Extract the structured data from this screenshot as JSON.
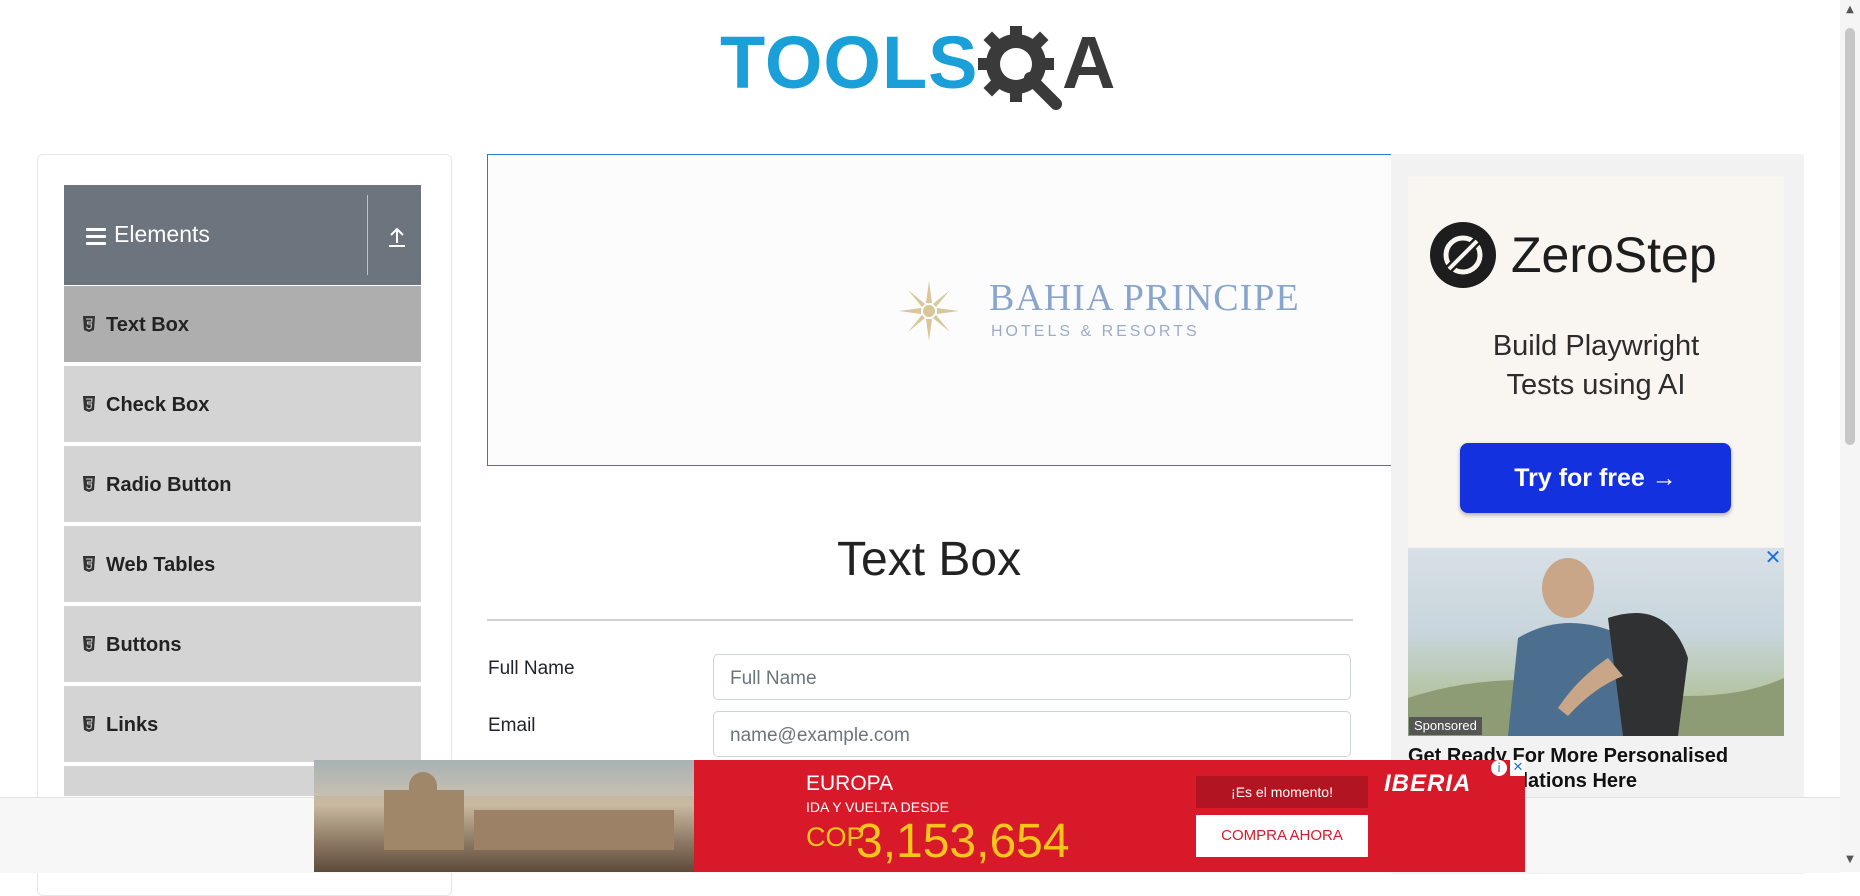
{
  "header": {
    "logo_text_left": "TOOLS",
    "logo_text_right": "A",
    "logo_icon": "gear-magnifier-icon"
  },
  "sidebar": {
    "group_title": "Elements",
    "items": [
      {
        "label": "Text Box",
        "active": true
      },
      {
        "label": "Check Box",
        "active": false
      },
      {
        "label": "Radio Button",
        "active": false
      },
      {
        "label": "Web Tables",
        "active": false
      },
      {
        "label": "Buttons",
        "active": false
      },
      {
        "label": "Links",
        "active": false
      }
    ]
  },
  "top_ad": {
    "brand": "BAHIA PRINCIPE",
    "subtitle": "HOTELS & RESORTS"
  },
  "main": {
    "title": "Text Box",
    "fields": [
      {
        "label": "Full Name",
        "placeholder": "Full Name"
      },
      {
        "label": "Email",
        "placeholder": "name@example.com"
      }
    ]
  },
  "right_ad": {
    "brand": "ZeroStep",
    "tagline_line1": "Build Playwright",
    "tagline_line2": "Tests using AI",
    "cta": "Try for free →",
    "sponsored": "Sponsored",
    "caption_line1": "Get Ready For More Personalised",
    "caption_line2": "Recommendations Here"
  },
  "bottom_ad": {
    "destination": "EUROPA",
    "trip_type": "IDA Y VUELTA DESDE",
    "currency": "COP",
    "price": "3,153,654",
    "moment": "¡Es el momento!",
    "cta": "COMPRA AHORA",
    "brand": "IBERIA"
  },
  "colors": {
    "accent_blue": "#1a9fd8",
    "sidebar_header": "#6c757d",
    "cta_blue": "#1431e0",
    "iberia_red": "#d7192a"
  }
}
